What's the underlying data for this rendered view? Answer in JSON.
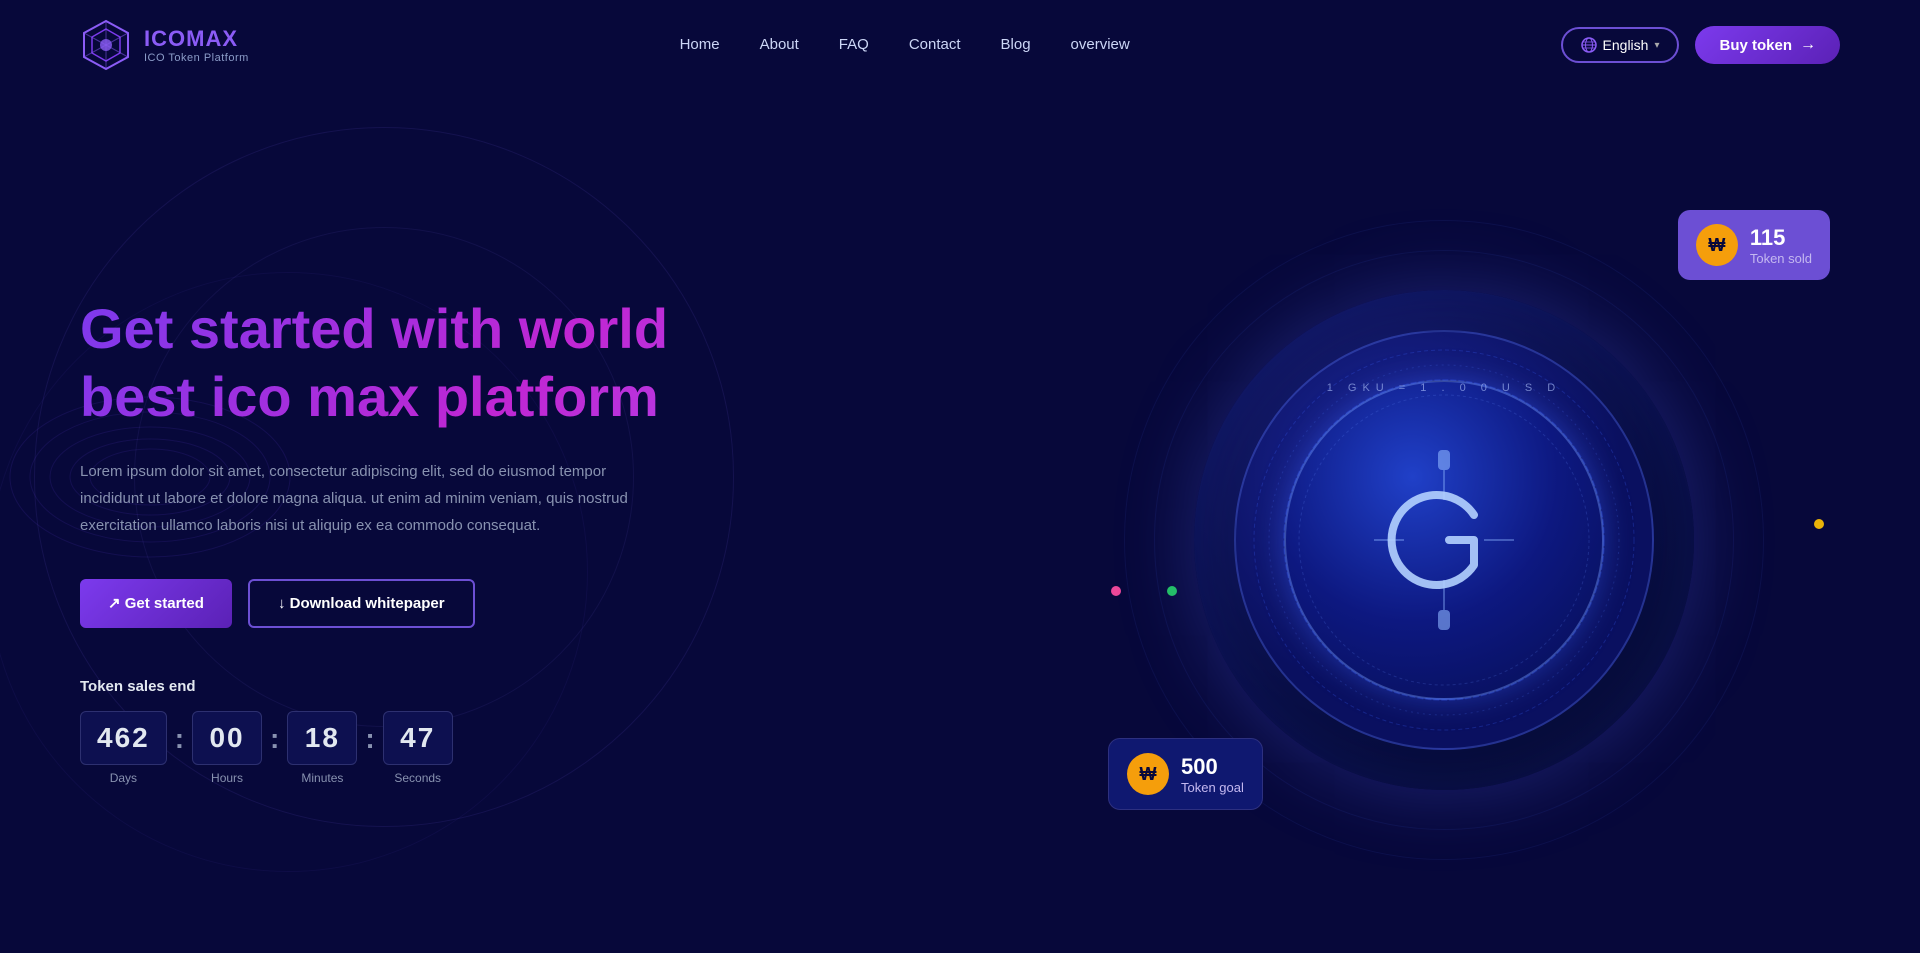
{
  "logo": {
    "name": "ICOMAX",
    "tagline": "ICO Token Platform"
  },
  "nav": {
    "links": [
      {
        "label": "Home",
        "href": "#"
      },
      {
        "label": "About",
        "href": "#"
      },
      {
        "label": "FAQ",
        "href": "#"
      },
      {
        "label": "Contact",
        "href": "#"
      },
      {
        "label": "Blog",
        "href": "#"
      },
      {
        "label": "overview",
        "href": "#"
      }
    ],
    "language_button": "English",
    "buy_button": "Buy token"
  },
  "hero": {
    "title_line1": "Get started with world",
    "title_line2": "best ico max platform",
    "description": "Lorem ipsum dolor sit amet, consectetur adipiscing elit, sed do eiusmod tempor incididunt ut labore et dolore magna aliqua. ut enim ad minim veniam, quis nostrud exercitation ullamco laboris nisi ut aliquip ex ea commodo consequat.",
    "cta_primary": "↗ Get started",
    "cta_secondary": "↓ Download whitepaper"
  },
  "countdown": {
    "label": "Token sales end",
    "days_value": "462",
    "days_unit": "Days",
    "hours_value": "00",
    "hours_unit": "Hours",
    "minutes_value": "18",
    "minutes_unit": "Minutes",
    "seconds_value": "47",
    "seconds_unit": "Seconds"
  },
  "coin": {
    "rate_text": "1 GKU  =  1 . 0 0   U S D",
    "symbol": "G"
  },
  "badges": {
    "token_sold": {
      "number": "115",
      "label": "Token sold"
    },
    "token_goal": {
      "number": "500",
      "label": "Token goal"
    }
  },
  "colors": {
    "purple_accent": "#7c3aed",
    "yellow_accent": "#f59e0b",
    "bg_dark": "#07083a",
    "nav_border": "#6c4fd4"
  }
}
